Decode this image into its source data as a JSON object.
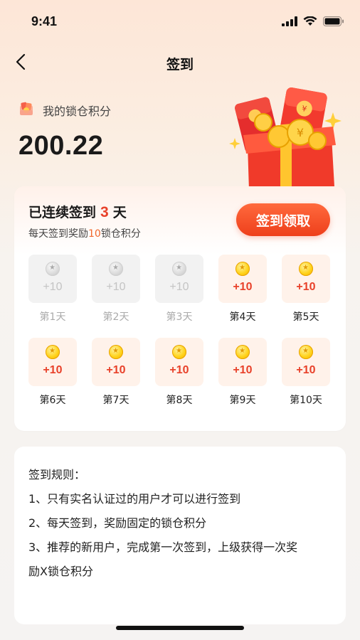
{
  "status_bar": {
    "time": "9:41"
  },
  "nav": {
    "title": "签到"
  },
  "points": {
    "label": "我的锁仓积分",
    "value": "200.22"
  },
  "checkin": {
    "streak_prefix": "已连续签到",
    "streak_days": "3",
    "streak_suffix": "天",
    "reward_prefix": "每天签到奖励",
    "reward_amount": "10",
    "reward_suffix": "锁仓积分",
    "button_label": "签到领取",
    "days": [
      {
        "label": "第1天",
        "points": "+10",
        "status": "claimed"
      },
      {
        "label": "第2天",
        "points": "+10",
        "status": "claimed"
      },
      {
        "label": "第3天",
        "points": "+10",
        "status": "claimed"
      },
      {
        "label": "第4天",
        "points": "+10",
        "status": "pending"
      },
      {
        "label": "第5天",
        "points": "+10",
        "status": "pending"
      },
      {
        "label": "第6天",
        "points": "+10",
        "status": "pending"
      },
      {
        "label": "第7天",
        "points": "+10",
        "status": "pending"
      },
      {
        "label": "第8天",
        "points": "+10",
        "status": "pending"
      },
      {
        "label": "第9天",
        "points": "+10",
        "status": "pending"
      },
      {
        "label": "第10天",
        "points": "+10",
        "status": "pending"
      }
    ]
  },
  "rules": {
    "title": "签到规则：",
    "lines": [
      "1、只有实名认证过的用户才可以进行签到",
      "2、每天签到，奖励固定的锁仓积分",
      "3、推荐的新用户，完成第一次签到，上级获得一次奖",
      "励X锁仓积分"
    ]
  },
  "colors": {
    "accent": "#e8412a",
    "button": "#ee3f1b",
    "pending_bg": "#fff2ea",
    "claimed_bg": "#f2f2f2"
  },
  "icons": {
    "back": "chevron-left-icon",
    "points": "gift-points-icon",
    "coin": "coin-icon",
    "illustration": "red-envelope-gift-box-icon"
  }
}
